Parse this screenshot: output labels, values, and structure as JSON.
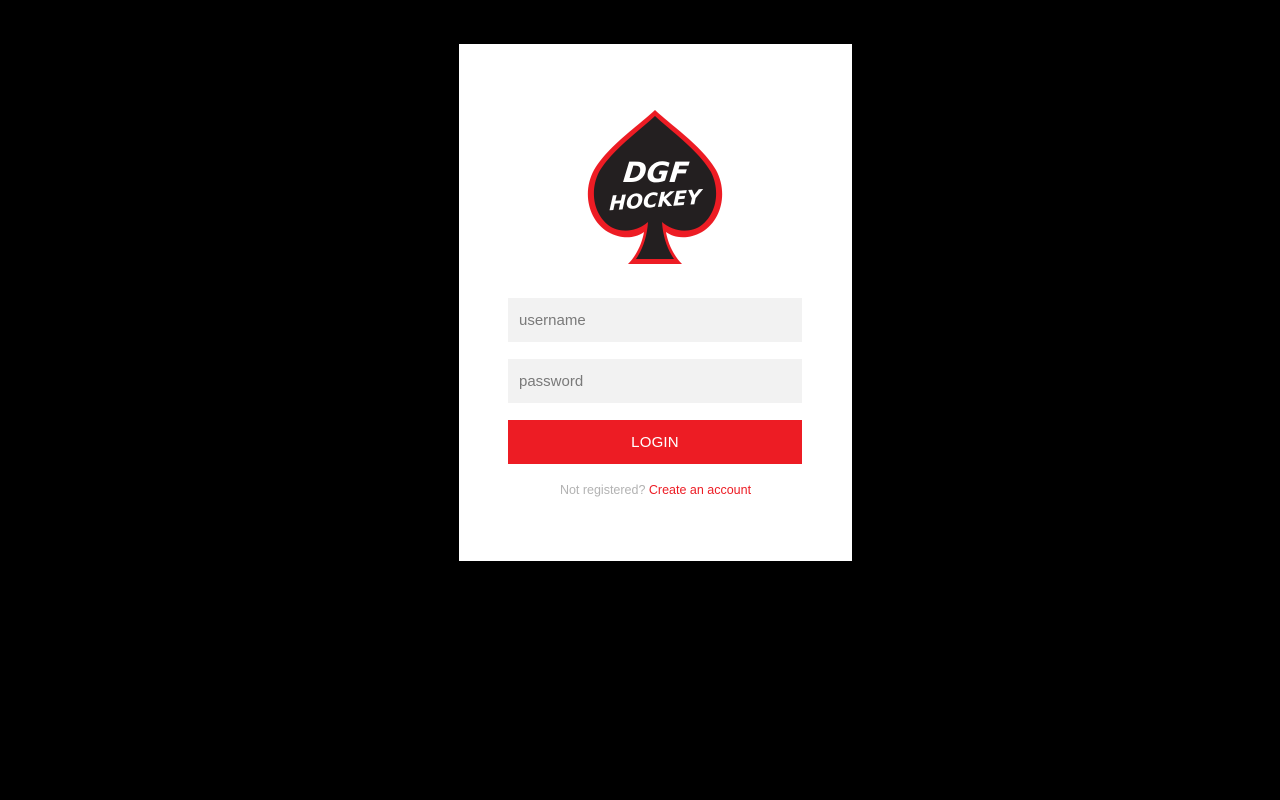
{
  "brand": {
    "logo_text_line1": "DGF",
    "logo_text_line2": "HOCKEY",
    "accent_color": "#ed1c24",
    "logo_fill_color": "#231f20"
  },
  "form": {
    "username_placeholder": "username",
    "username_value": "",
    "password_placeholder": "password",
    "password_value": "",
    "login_label": "LOGIN",
    "register_prompt": "Not registered?",
    "register_link_label": "Create an account"
  },
  "colors": {
    "page_background": "#000000",
    "card_background": "#ffffff",
    "input_background": "#f2f2f2",
    "muted_text": "#b3b3b3"
  }
}
